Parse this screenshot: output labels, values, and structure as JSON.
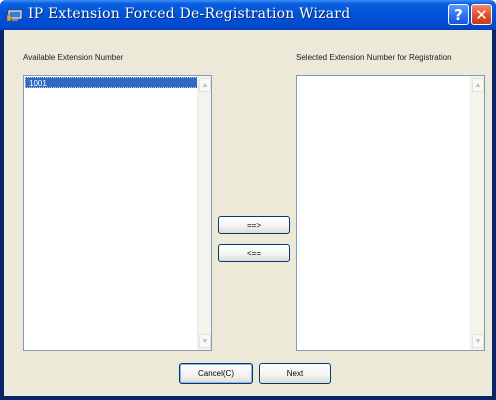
{
  "window": {
    "title": "IP Extension Forced De-Registration Wizard",
    "help_glyph": "?",
    "close_glyph": "✕"
  },
  "left_panel": {
    "label": "Available Extension Number",
    "items": [
      "1001"
    ]
  },
  "right_panel": {
    "label": "Selected Extension Number for Registration",
    "items": []
  },
  "buttons": {
    "add": "==>",
    "remove": "<==",
    "cancel": "Cancel(C)",
    "next": "Next"
  },
  "scroll": {
    "up": "▲",
    "down": "▼"
  },
  "colors": {
    "titlebar": "#0053d8",
    "selection": "#316ac5",
    "dialog_bg": "#ece9d8"
  }
}
